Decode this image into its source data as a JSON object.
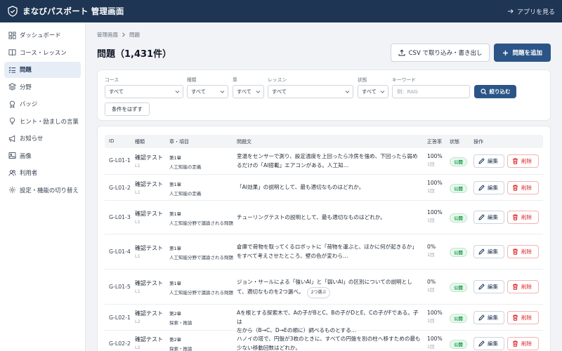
{
  "app": {
    "title": "まなびパスポート 管理画面",
    "view_app_label": "アプリを見る"
  },
  "sidebar": {
    "items": [
      {
        "label": "ダッシュボード",
        "icon": "dashboard-icon"
      },
      {
        "label": "コース・レッスン",
        "icon": "book-icon"
      },
      {
        "label": "問題",
        "icon": "list-check-icon",
        "active": true
      },
      {
        "label": "分野",
        "icon": "layers-icon"
      },
      {
        "label": "バッジ",
        "icon": "award-icon"
      },
      {
        "label": "ヒント・励ましの言葉",
        "icon": "lightbulb-icon"
      },
      {
        "label": "お知らせ",
        "icon": "megaphone-icon"
      },
      {
        "label": "画像",
        "icon": "image-icon"
      },
      {
        "label": "利用者",
        "icon": "users-icon"
      },
      {
        "label": "設定・機能の切り替え",
        "icon": "gear-icon"
      }
    ]
  },
  "breadcrumb": {
    "root": "管理画面",
    "current": "問題"
  },
  "header": {
    "title": "問題（1,431件）",
    "csv_label": "CSV で取り込み・書き出し",
    "add_label": "問題を追加"
  },
  "filters": {
    "course": {
      "label": "コース",
      "value": "すべて"
    },
    "type": {
      "label": "種類",
      "value": "すべて"
    },
    "chapter": {
      "label": "章",
      "value": "すべて"
    },
    "lesson": {
      "label": "レッスン",
      "value": "すべて"
    },
    "status": {
      "label": "状態",
      "value": "すべて"
    },
    "keyword": {
      "label": "キーワード",
      "placeholder": "例：RAG"
    },
    "search_label": "絞り込む",
    "reset_label": "条件をはずす"
  },
  "table": {
    "headers": {
      "id": "ID",
      "type": "種類",
      "chapter": "章・項目",
      "question": "問題文",
      "accuracy": "正答率",
      "status": "状態",
      "actions": "操作"
    },
    "edit_label": "編集",
    "delete_label": "削除",
    "rows": [
      {
        "id": "G-L01-1",
        "type": "確認テスト",
        "level": "L1",
        "chapter": "第1章",
        "topic": "人工知能の定義",
        "q1": "室温をセンサーで測り、設定温度を上回ったら冷房を強め、下回ったら弱め",
        "q2": "るだけの「AI搭載」エアコンがある。人工知…",
        "tag": "",
        "accuracy": "100%",
        "attempts": "1回",
        "status": "公開"
      },
      {
        "id": "G-L01-2",
        "type": "確認テスト",
        "level": "L1",
        "chapter": "第1章",
        "topic": "人工知能の定義",
        "q1": "「AI効果」の説明として、最も適切なものはどれか。",
        "q2": "",
        "tag": "",
        "accuracy": "100%",
        "attempts": "1回",
        "status": "公開"
      },
      {
        "id": "G-L01-3",
        "type": "確認テスト",
        "level": "L1",
        "chapter": "第1章",
        "topic": "人工知能分野で議論される問題",
        "q1": "チューリングテストの説明として、最も適切なものはどれか。",
        "q2": "",
        "tag": "",
        "accuracy": "100%",
        "attempts": "1回",
        "status": "公開"
      },
      {
        "id": "G-L01-4",
        "type": "確認テスト",
        "level": "L1",
        "chapter": "第1章",
        "topic": "人工知能分野で議論される問題",
        "q1": "倉庫で荷物を取ってくるロボットに「荷物を運ぶと、ほかに何が起きるか」",
        "q2": "をすべて考えさせたところ、壁の色が変わら…",
        "tag": "",
        "accuracy": "0%",
        "attempts": "1回",
        "status": "公開"
      },
      {
        "id": "G-L01-5",
        "type": "確認テスト",
        "level": "L1",
        "chapter": "第1章",
        "topic": "人工知能分野で議論される問題",
        "q1": "ジョン・サールによる「強いAI」と「弱いAI」の区別についての説明とし",
        "q2": "て、適切なものを2つ選べ。",
        "tag": "2つ選ぶ",
        "accuracy": "0%",
        "attempts": "1回",
        "status": "公開"
      },
      {
        "id": "G-L02-1",
        "type": "確認テスト",
        "level": "L2",
        "chapter": "第2章",
        "topic": "探索・推論",
        "q1": "Aを根とする探索木で、Aの子がBとC、Bの子がDとE、Cの子がFである。子は",
        "q2": "左から（B→C、D→Eの順に）調べるものとする…",
        "tag": "",
        "accuracy": "100%",
        "attempts": "1回",
        "status": "公開"
      },
      {
        "id": "G-L02-2",
        "type": "確認テスト",
        "level": "L2",
        "chapter": "第2章",
        "topic": "探索・推論",
        "q1": "ハノイの塔で、円盤が3枚のときに、すべての円盤を別の柱へ移すための最も",
        "q2": "少ない移動回数はどれか。",
        "tag": "",
        "accuracy": "100%",
        "attempts": "1回",
        "status": "公開"
      }
    ]
  }
}
